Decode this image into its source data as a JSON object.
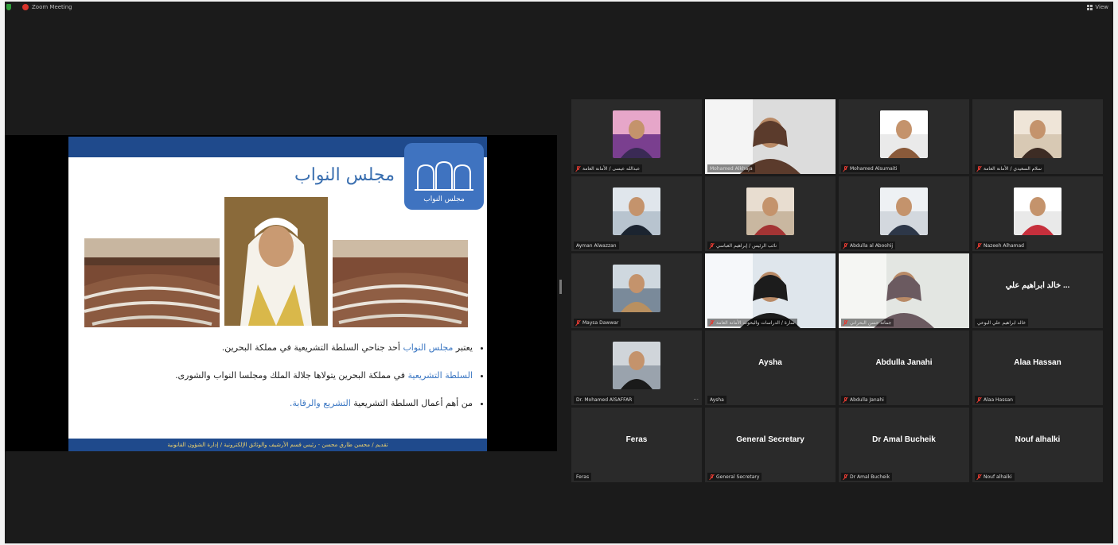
{
  "app": {
    "title": "Zoom Meeting",
    "view_label": "View"
  },
  "slide": {
    "title": "مجلس النواب",
    "logo_text": "مجلس النواب",
    "bullets": [
      {
        "pre": "يعتبر ",
        "hl": "مجلس النواب",
        "post": " أحد جناحي السلطة التشريعية في مملكة البحرين."
      },
      {
        "pre": "",
        "hl": "السلطة التشريعية",
        "post": " في مملكة البحرين يتولاها جلالة الملك ومجلسا النواب والشورى."
      },
      {
        "pre": "من أهم أعمال السلطة التشريعية ",
        "hl": "التشريع والرقابة.",
        "post": ""
      }
    ],
    "footer": "تقديم / محسن طارق محسن - رئيس قسم الأرشيف والوثائق الإلكترونية / إدارة الشؤون القانونية"
  },
  "participants": [
    {
      "name": "عبدالله عيسى / الأمانة العامة",
      "muted": true,
      "kind": "avatar",
      "colors": [
        "#7a3f8f",
        "#e6a6c9",
        "#3a2a55"
      ]
    },
    {
      "name": "Mohamed Alkhaja",
      "muted": false,
      "kind": "video",
      "active": true,
      "colors": [
        "#dcdcdc",
        "#f4f4f4",
        "#5b3b2c"
      ]
    },
    {
      "name": "Mohamed Alsumaiti",
      "muted": true,
      "kind": "avatar",
      "colors": [
        "#eaeaea",
        "#ffffff",
        "#8a5a3a"
      ]
    },
    {
      "name": "سلام السعيدي / الأمانة العامة",
      "muted": true,
      "kind": "avatar",
      "colors": [
        "#d8c9b4",
        "#efe5d8",
        "#3d2c24"
      ]
    },
    {
      "name": "Ayman Alwazzan",
      "muted": false,
      "kind": "avatar",
      "colors": [
        "#b8c4cf",
        "#e0e6ec",
        "#1b2430"
      ]
    },
    {
      "name": "نائب الرئيس / إبراهيم العباسي",
      "muted": true,
      "kind": "avatar",
      "colors": [
        "#c9b7a0",
        "#e8ddd0",
        "#a33434"
      ]
    },
    {
      "name": "Abdulla al Aboohij",
      "muted": true,
      "kind": "avatar",
      "colors": [
        "#d3d8de",
        "#eef1f4",
        "#2d3748"
      ]
    },
    {
      "name": "Nazeeh Alhamad",
      "muted": true,
      "kind": "avatar",
      "colors": [
        "#e9e9e9",
        "#ffffff",
        "#c62f3c"
      ]
    },
    {
      "name": "Maysa Dawwar",
      "muted": true,
      "kind": "avatar",
      "colors": [
        "#7a8a9a",
        "#cfd8df",
        "#b99060"
      ]
    },
    {
      "name": "سارة / الدراسات والبحوث الأمانة العامة",
      "muted": true,
      "kind": "video",
      "colors": [
        "#dfe6ec",
        "#f6f8fa",
        "#1c1c1c"
      ]
    },
    {
      "name": "جمانة حسن البحراني",
      "muted": true,
      "kind": "video",
      "colors": [
        "#e3e6e2",
        "#f5f6f3",
        "#6b5a60"
      ]
    },
    {
      "name": "خالد ابراهيم علي البوعي",
      "muted": false,
      "kind": "name",
      "display": "خالد ابراهيم علي ..."
    },
    {
      "name": "Dr. Mohamed AlSAFFAR",
      "muted": false,
      "kind": "avatar",
      "colors": [
        "#9aa3ad",
        "#d0d5da",
        "#1a1a1a"
      ],
      "dots": true
    },
    {
      "name": "Aysha",
      "muted": false,
      "kind": "name",
      "display": "Aysha"
    },
    {
      "name": "Abdulla Janahi",
      "muted": true,
      "kind": "name",
      "display": "Abdulla Janahi"
    },
    {
      "name": "Alaa Hassan",
      "muted": true,
      "kind": "name",
      "display": "Alaa Hassan"
    },
    {
      "name": "Feras",
      "muted": false,
      "kind": "name",
      "display": "Feras"
    },
    {
      "name": "General Secretary",
      "muted": true,
      "kind": "name",
      "display": "General Secretary"
    },
    {
      "name": "Dr Amal Bucheik",
      "muted": true,
      "kind": "name",
      "display": "Dr Amal Bucheik"
    },
    {
      "name": "Nouf alhalki",
      "muted": true,
      "kind": "name",
      "display": "Nouf alhalki"
    }
  ]
}
